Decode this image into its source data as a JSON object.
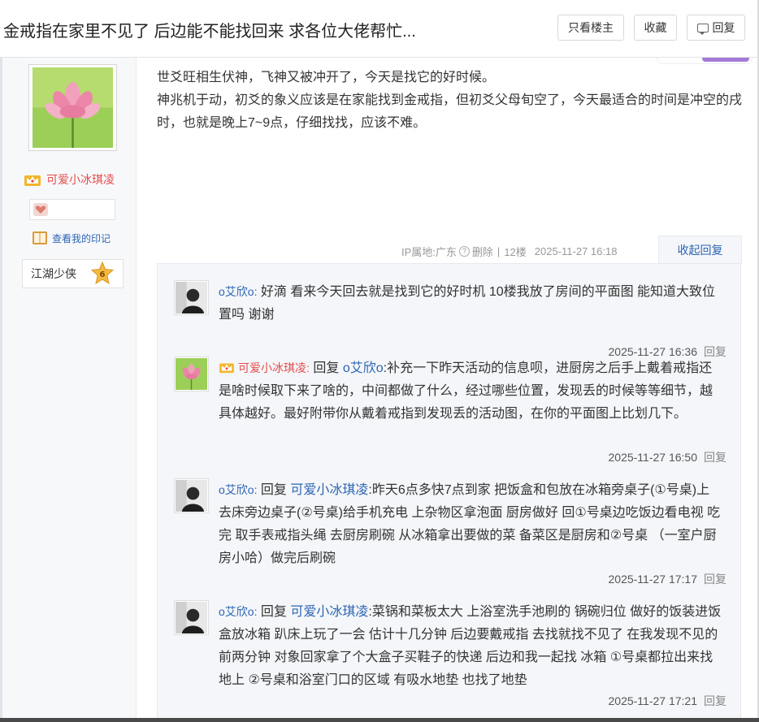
{
  "header": {
    "title": "金戒指在家里不见了 后边能不能找回来 求各位大佬帮忙...",
    "btn_only_op": "只看楼主",
    "btn_favorite": "收藏",
    "btn_reply": "回复"
  },
  "author": {
    "name": "可爱小冰琪凌",
    "mark_link": "查看我的印记",
    "level_title": "江湖少侠",
    "level_num": "6"
  },
  "post": {
    "para1": "世爻旺相生伏神，飞神又被冲开了，今天是找它的好时候。",
    "para2": "神兆机于动，初爻的象义应该是在家能找到金戒指，但初爻父母旬空了，今天最适合的时间是冲空的戌时，也就是晚上7~9点，仔细找找，应该不难。",
    "ip": "IP属地:广东",
    "help": "?",
    "delete": "删除",
    "sep": "|",
    "floor": "12楼",
    "time": "2025-11-27 16:18",
    "collapse": "收起回复"
  },
  "replies": [
    {
      "name": "o艾欣o:",
      "text": "好滴 看来今天回去就是找到它的好时机 10楼我放了房间的平面图 能知道大致位置吗 谢谢",
      "time": "2025-11-27 16:36",
      "reply_btn": "回复"
    },
    {
      "name": "可爱小冰琪凌:",
      "reply_word": "回复",
      "target": "o艾欣o",
      "text": ":补充一下昨天活动的信息呗，进厨房之后手上戴着戒指还是啥时候取下来了啥的，中间都做了什么，经过哪些位置，发现丢的时候等等细节，越具体越好。最好附带你从戴着戒指到发现丢的活动图，在你的平面图上比划几下。",
      "time": "2025-11-27 16:50",
      "reply_btn": "回复"
    },
    {
      "name": "o艾欣o:",
      "reply_word": "回复",
      "target": "可爱小冰琪凌",
      "text": ":昨天6点多快7点到家 把饭盒和包放在冰箱旁桌子(①号桌)上 去床旁边桌子(②号桌)给手机充电 上杂物区拿泡面 厨房做好 回①号桌边吃饭边看电视 吃完 取手表戒指头绳 去厨房刷碗 从冰箱拿出要做的菜 备菜区是厨房和②号桌 （一室户厨房小哈）做完后刷碗",
      "time": "2025-11-27 17:17",
      "reply_btn": "回复"
    },
    {
      "name": "o艾欣o:",
      "reply_word": "回复",
      "target": "可爱小冰琪凌",
      "text": ":菜锅和菜板太大 上浴室洗手池刷的 锅碗归位 做好的饭装进饭盒放冰箱 趴床上玩了一会 估计十几分钟 后边要戴戒指 去找就找不见了 在我发现不见的前两分钟 对象回家拿了个大盒子买鞋子的快递 后边和我一起找 冰箱 ①号桌都拉出来找地上 ②号桌和浴室门口的区域 有吸水地垫 也找了地垫",
      "time": "2025-11-27 17:21",
      "reply_btn": "回复"
    }
  ]
}
